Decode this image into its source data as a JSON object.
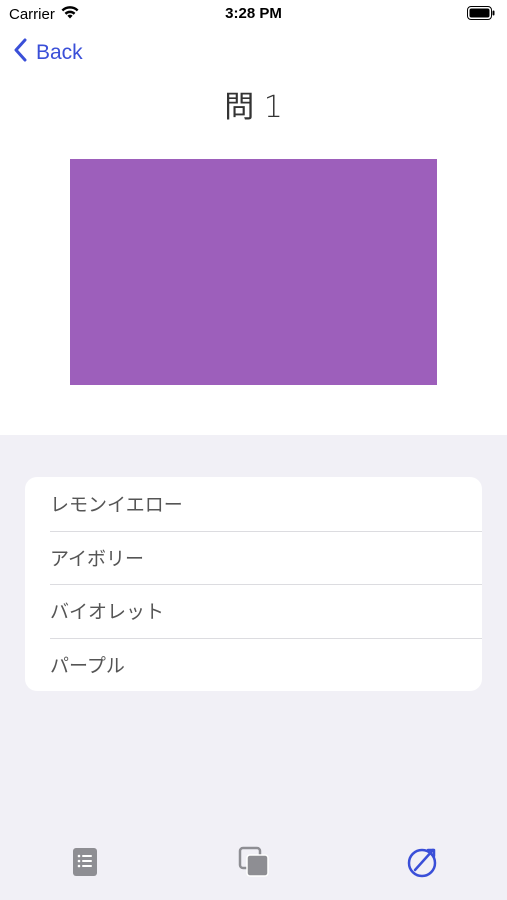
{
  "status_bar": {
    "carrier": "Carrier",
    "time": "3:28 PM"
  },
  "nav": {
    "back_label": "Back"
  },
  "question": {
    "title": "問 1",
    "swatch_color": "#9d5fbb"
  },
  "options": [
    {
      "label": "レモンイエロー"
    },
    {
      "label": "アイボリー"
    },
    {
      "label": "バイオレット"
    },
    {
      "label": "パープル"
    }
  ],
  "tab_bar": {
    "tabs": [
      {
        "icon": "list-icon",
        "active": false
      },
      {
        "icon": "stack-icon",
        "active": false
      },
      {
        "icon": "compass-icon",
        "active": true
      }
    ]
  },
  "colors": {
    "accent": "#3a4fd8",
    "inactive": "#8e8e93",
    "background_lower": "#f1f0f6"
  }
}
